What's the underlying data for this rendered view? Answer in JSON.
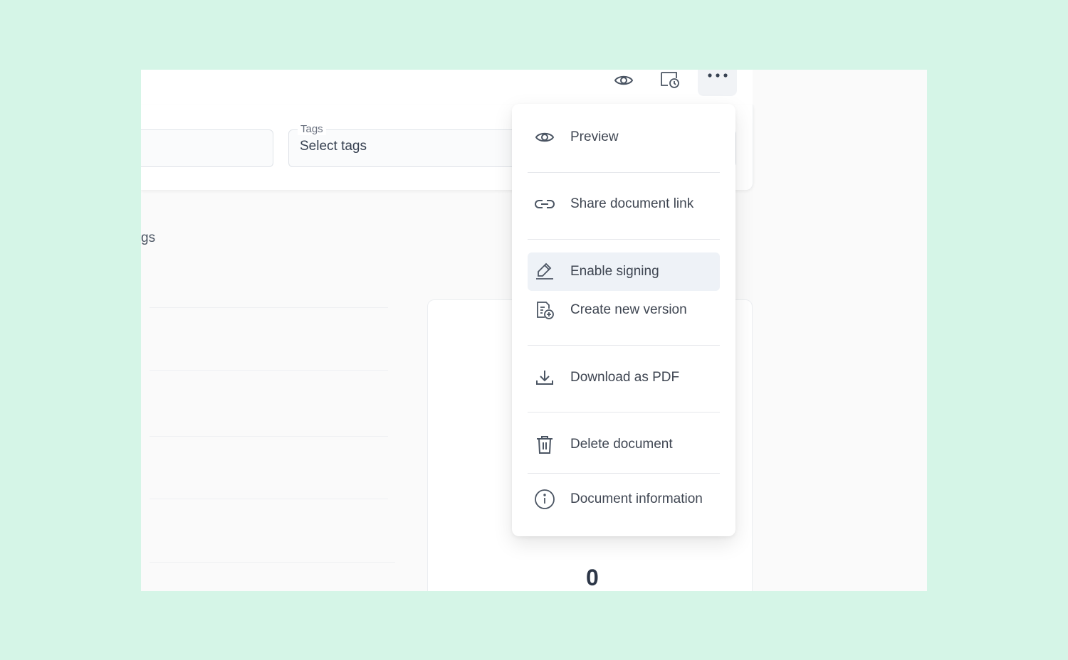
{
  "toolbar": {
    "preview_icon": "eye-icon",
    "history_icon": "calendar-clock-icon",
    "more_icon": "ellipsis-icon"
  },
  "filters": {
    "tags_label": "Tags",
    "tags_placeholder": "Select tags"
  },
  "page": {
    "partial_label": "gs"
  },
  "stats": {
    "value": "0"
  },
  "menu": {
    "items": [
      {
        "label": "Preview",
        "icon": "eye-icon"
      },
      {
        "label": "Share document link",
        "icon": "link-icon"
      },
      {
        "label": "Enable signing",
        "icon": "signature-icon"
      },
      {
        "label": "Create new version",
        "icon": "file-plus-icon"
      },
      {
        "label": "Download as PDF",
        "icon": "download-icon"
      },
      {
        "label": "Delete document",
        "icon": "trash-icon"
      },
      {
        "label": "Document information",
        "icon": "info-icon"
      }
    ]
  },
  "colors": {
    "background": "#d5f5e7",
    "active_item": "#eef2f7",
    "text": "#3f4652"
  }
}
